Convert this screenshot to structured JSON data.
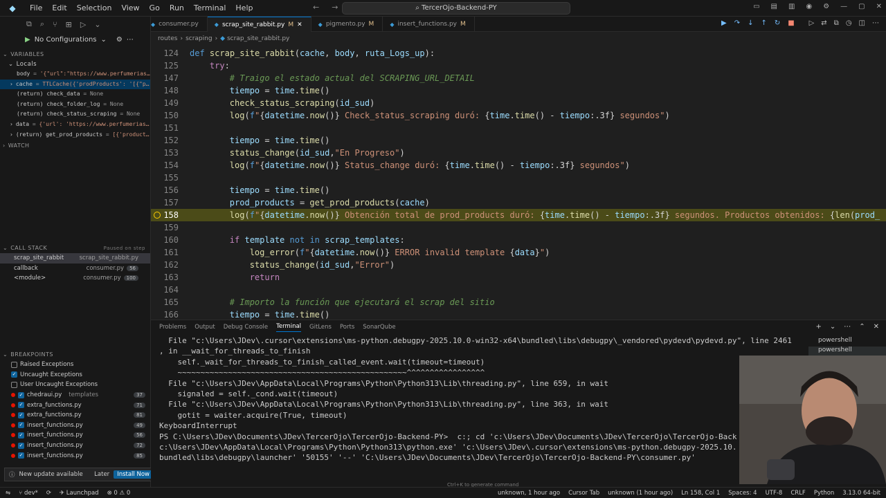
{
  "titlebar": {
    "menu": [
      "File",
      "Edit",
      "Selection",
      "View",
      "Go",
      "Run",
      "Terminal",
      "Help"
    ],
    "search": "TercerOjo-Backend-PY"
  },
  "sidebar": {
    "run_config": "No Configurations",
    "variables_header": "VARIABLES",
    "locals_header": "Locals",
    "locals": [
      {
        "key": "body",
        "value": "'{\"url\":\"https://www.perfumerias…"
      },
      {
        "key": "cache",
        "value": "TTLCache({'prodProducts': '[{\"p…"
      },
      {
        "key": "(return) check_data",
        "value": "None"
      },
      {
        "key": "(return) check_folder_log",
        "value": "None"
      },
      {
        "key": "(return) check_status_scraping",
        "value": "None"
      },
      {
        "key": "data",
        "value": "{'url': 'https://www.perfumerias…"
      },
      {
        "key": "(return) get_prod_products",
        "value": "[{'product…"
      }
    ],
    "watch_header": "WATCH",
    "callstack_header": "CALL STACK",
    "callstack_status": "Paused on step",
    "callstack": [
      {
        "name": "scrap_site_rabbit",
        "file": "scrap_site_rabbit.py",
        "badge": ""
      },
      {
        "name": "callback",
        "file": "consumer.py",
        "badge": "56"
      },
      {
        "name": "<module>",
        "file": "consumer.py",
        "badge": "100"
      }
    ],
    "breakpoints_header": "BREAKPOINTS",
    "breakpoints": [
      {
        "label": "Raised Exceptions",
        "checked": false,
        "dot": false,
        "extra": "",
        "count": ""
      },
      {
        "label": "Uncaught Exceptions",
        "checked": true,
        "dot": false,
        "extra": "",
        "count": ""
      },
      {
        "label": "User Uncaught Exceptions",
        "checked": false,
        "dot": false,
        "extra": "",
        "count": ""
      },
      {
        "label": "chedraui.py",
        "checked": true,
        "dot": true,
        "extra": "templates",
        "count": "37"
      },
      {
        "label": "extra_functions.py",
        "checked": true,
        "dot": true,
        "extra": "",
        "count": "71"
      },
      {
        "label": "extra_functions.py",
        "checked": true,
        "dot": true,
        "extra": "",
        "count": "81"
      },
      {
        "label": "insert_functions.py",
        "checked": true,
        "dot": true,
        "extra": "",
        "count": "49"
      },
      {
        "label": "insert_functions.py",
        "checked": true,
        "dot": true,
        "extra": "",
        "count": "56"
      },
      {
        "label": "insert_functions.py",
        "checked": true,
        "dot": true,
        "extra": "",
        "count": "72"
      },
      {
        "label": "insert_functions.py",
        "checked": true,
        "dot": true,
        "extra": "",
        "count": "85"
      }
    ],
    "toast": {
      "text": "New update available",
      "later": "Later",
      "install": "Install Now"
    }
  },
  "tabs": [
    {
      "label": "consumer.py",
      "mod": "",
      "active": false
    },
    {
      "label": "scrap_site_rabbit.py",
      "mod": "M",
      "active": true
    },
    {
      "label": "pigmento.py",
      "mod": "M",
      "active": false
    },
    {
      "label": "insert_functions.py",
      "mod": "M",
      "active": false
    }
  ],
  "breadcrumb": [
    "routes",
    "scraping",
    "scrap_site_rabbit.py"
  ],
  "code": [
    {
      "n": "124",
      "html": "<span class='kwb'>def</span> <span class='fn'>scrap_site_rabbit</span>(<span class='var2'>cache</span>, <span class='var2'>body</span>, <span class='var2'>ruta_Logs_up</span>):"
    },
    {
      "n": "125",
      "html": "    <span class='kw'>try</span>:"
    },
    {
      "n": "147",
      "html": "        <span class='cm'># Traigo el estado actual del SCRAPING_URL_DETAIL</span>"
    },
    {
      "n": "148",
      "html": "        <span class='var2'>tiempo</span> = <span class='var2'>time</span>.<span class='fn'>time</span>()"
    },
    {
      "n": "149",
      "html": "        <span class='fn'>check_status_scraping</span>(<span class='var2'>id_sud</span>)"
    },
    {
      "n": "150",
      "html": "        <span class='fn'>log</span>(<span class='kwb'>f</span><span class='str'>\"</span>{<span class='var2'>datetime</span>.<span class='fn'>now</span>()}<span class='str'> Check_status_scraping duró: </span>{<span class='var2'>time</span>.<span class='fn'>time</span>() - <span class='var2'>tiempo</span>:.3f}<span class='str'> segundos\"</span>)"
    },
    {
      "n": "151",
      "html": ""
    },
    {
      "n": "152",
      "html": "        <span class='var2'>tiempo</span> = <span class='var2'>time</span>.<span class='fn'>time</span>()"
    },
    {
      "n": "153",
      "html": "        <span class='fn'>status_change</span>(<span class='var2'>id_sud</span>,<span class='str'>\"En Progreso\"</span>)"
    },
    {
      "n": "154",
      "html": "        <span class='fn'>log</span>(<span class='kwb'>f</span><span class='str'>\"</span>{<span class='var2'>datetime</span>.<span class='fn'>now</span>()}<span class='str'> Status_change duró: </span>{<span class='var2'>time</span>.<span class='fn'>time</span>() - <span class='var2'>tiempo</span>:.3f}<span class='str'> segundos\"</span>)"
    },
    {
      "n": "155",
      "html": ""
    },
    {
      "n": "156",
      "html": "        <span class='var2'>tiempo</span> = <span class='var2'>time</span>.<span class='fn'>time</span>()"
    },
    {
      "n": "157",
      "html": "        <span class='var2'>prod_products</span> = <span class='fn'>get_prod_products</span>(<span class='var2'>cache</span>)"
    },
    {
      "n": "158",
      "html": "        <span class='fn'>log</span>(<span class='kwb'>f</span><span class='str'>\"</span>{<span class='var2'>datetime</span>.<span class='fn'>now</span>()}<span class='str'> Obtención total de prod_products duró: </span>{<span class='var2'>time</span>.<span class='fn'>time</span>() - <span class='var2'>tiempo</span>:.3f}<span class='str'> segundos. Productos obtenidos: </span>{<span class='fn'>len</span>(<span class='var2'>prod_</span>"
    },
    {
      "n": "159",
      "html": ""
    },
    {
      "n": "160",
      "html": "        <span class='kw'>if</span> <span class='var2'>template</span> <span class='kwb'>not</span> <span class='kwb'>in</span> <span class='var2'>scrap_templates</span>:"
    },
    {
      "n": "161",
      "html": "            <span class='fn'>log_error</span>(<span class='kwb'>f</span><span class='str'>\"</span>{<span class='var2'>datetime</span>.<span class='fn'>now</span>()}<span class='str'> ERROR invalid template </span>{<span class='var2'>data</span>}<span class='str'>\"</span>)"
    },
    {
      "n": "162",
      "html": "            <span class='fn'>status_change</span>(<span class='var2'>id_sud</span>,<span class='str'>\"Error\"</span>)"
    },
    {
      "n": "163",
      "html": "            <span class='kw'>return</span>"
    },
    {
      "n": "164",
      "html": ""
    },
    {
      "n": "165",
      "html": "        <span class='cm'># Importo la función que ejecutará el scrap del sitio</span>"
    },
    {
      "n": "166",
      "html": "        <span class='var2'>tiempo</span> = <span class='var2'>time</span>.<span class='fn'>time</span>()"
    }
  ],
  "current_line": "158",
  "panel": {
    "tabs": [
      "Problems",
      "Output",
      "Debug Console",
      "Terminal",
      "GitLens",
      "Ports",
      "SonarQube"
    ],
    "active_tab": "Terminal",
    "shells": [
      "powershell",
      "powershell"
    ],
    "terminal_lines": [
      "  File \"c:\\Users\\JDev\\.cursor\\extensions\\ms-python.debugpy-2025.10.0-win32-x64\\bundled\\libs\\debugpy\\_vendored\\pydevd\\pydevd.py\", line 2461",
      ", in __wait_for_threads_to_finish",
      "    self._wait_for_threads_to_finish_called_event.wait(timeout=timeout)",
      "    ~~~~~~~~~~~~~~~~~~~~~~~~~~~~~~~~~~~~~~~~~~~~~~~~~~^^^^^^^^^^^^^^^^^",
      "  File \"c:\\Users\\JDev\\AppData\\Local\\Programs\\Python\\Python313\\Lib\\threading.py\", line 659, in wait",
      "    signaled = self._cond.wait(timeout)",
      "  File \"c:\\Users\\JDev\\AppData\\Local\\Programs\\Python\\Python313\\Lib\\threading.py\", line 363, in wait",
      "    gotit = waiter.acquire(True, timeout)",
      "KeyboardInterrupt",
      "PS C:\\Users\\JDev\\Documents\\JDev\\TercerOjo\\TercerOjo-Backend-PY>  c:; cd 'c:\\Users\\JDev\\Documents\\JDev\\TercerOjo\\TercerOjo-Back",
      "c:\\Users\\JDev\\AppData\\Local\\Programs\\Python\\Python313\\python.exe' 'c:\\Users\\JDev\\.cursor\\extensions\\ms-python.debugpy-2025.10.",
      "bundled\\libs\\debugpy\\launcher' '50155' '--' 'C:\\Users\\JDev\\Documents\\JDev\\TercerOjo\\TercerOjo-Backend-PY\\consumer.py'"
    ],
    "hint": "Ctrl+K to generate command"
  },
  "statusbar": {
    "left": [
      "dev*",
      "Launchpad",
      "0",
      "0"
    ],
    "right": [
      "unknown, 1 hour ago",
      "Cursor Tab",
      "unknown (1 hour ago)",
      "Ln 158, Col 1",
      "Spaces: 4",
      "UTF-8",
      "CRLF",
      "Python",
      "3.13.0 64-bit"
    ]
  }
}
